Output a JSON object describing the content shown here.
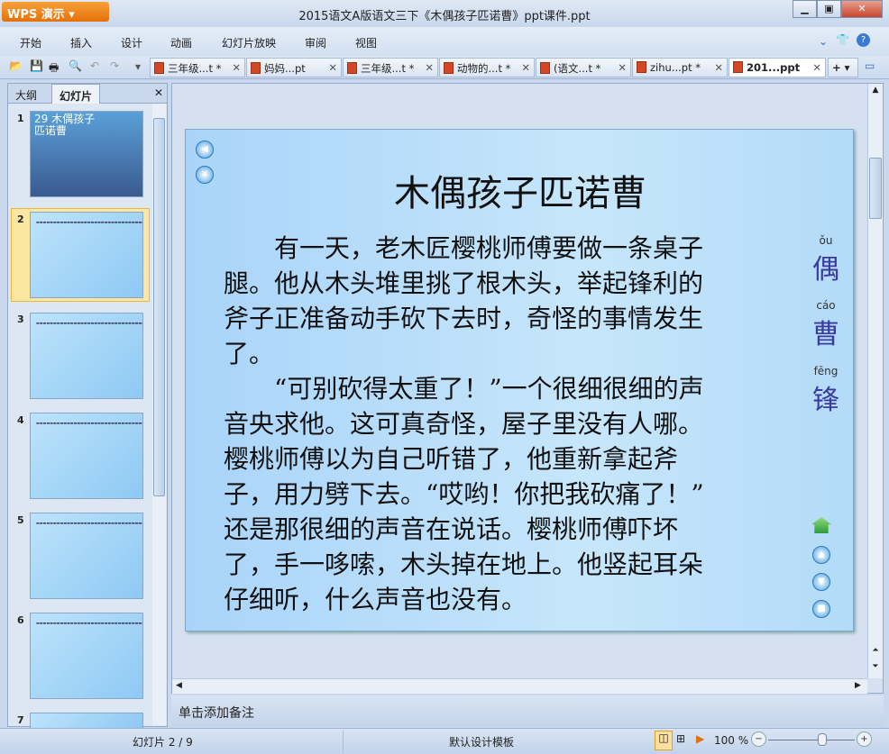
{
  "app": {
    "button": "WPS 演示",
    "title": "2015语文A版语文三下《木偶孩子匹诺曹》ppt课件.ppt"
  },
  "menu": [
    "开始",
    "插入",
    "设计",
    "动画",
    "幻灯片放映",
    "审阅",
    "视图"
  ],
  "tabs": [
    {
      "label": "三年级...t *",
      "active": false
    },
    {
      "label": "妈妈...pt",
      "active": false
    },
    {
      "label": "三年级...t *",
      "active": false
    },
    {
      "label": "动物的...t *",
      "active": false
    },
    {
      "label": "(语文...t *",
      "active": false
    },
    {
      "label": "zihu...pt *",
      "active": false
    },
    {
      "label": "201...ppt",
      "active": true
    }
  ],
  "left_pane": {
    "tabs": [
      "大纲",
      "幻灯片"
    ],
    "active_tab": "幻灯片",
    "slides": [
      "1",
      "2",
      "3",
      "4",
      "5",
      "6",
      "7"
    ],
    "selected": "2",
    "thumb1_title": "29 木偶孩子\n匹诺曹"
  },
  "slide": {
    "title": "木偶孩子匹诺曹",
    "lines": [
      "　　有一天，老木匠樱桃师傅要做一条桌子",
      "腿。他从木头堆里挑了根木头，举起锋利的",
      "斧子正准备动手砍下去时，奇怪的事情发生",
      "了。",
      "　　“可别砍得太重了！”一个很细很细的声",
      "音央求他。这可真奇怪，屋子里没有人哪。",
      "樱桃师傅以为自己听错了，他重新拿起斧",
      "子，用力劈下去。“哎哟！你把我砍痛了！”",
      "还是那很细的声音在说话。樱桃师傅吓坏",
      "了，手一哆嗦，木头掉在地上。他竖起耳朵",
      "仔细听，什么声音也没有。"
    ],
    "vocab": [
      {
        "pinyin": "ǒu",
        "char": "偶"
      },
      {
        "pinyin": "cáo",
        "char": "曹"
      },
      {
        "pinyin": "fēng",
        "char": "锋"
      }
    ]
  },
  "notes_placeholder": "单击添加备注",
  "status": {
    "slide": "幻灯片 2 / 9",
    "template": "默认设计模板",
    "zoom": "100 %",
    "zoom_value": 100
  }
}
